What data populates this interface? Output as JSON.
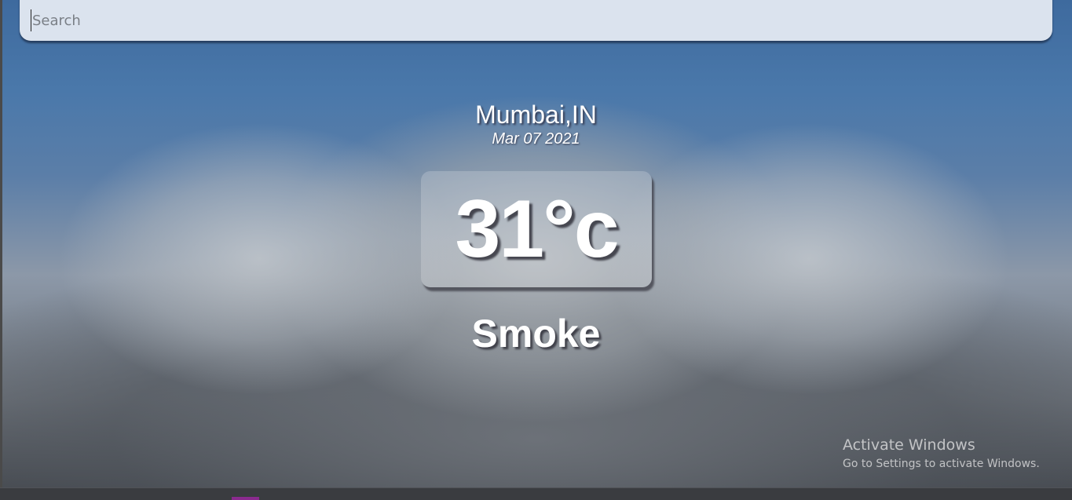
{
  "search": {
    "placeholder": "Search",
    "value": ""
  },
  "weather": {
    "location": "Mumbai,IN",
    "date": "Mar 07 2021",
    "temperature": "31°c",
    "condition": "Smoke"
  },
  "watermark": {
    "title": "Activate Windows",
    "subtitle": "Go to Settings to activate Windows."
  },
  "colors": {
    "search_bg": "#dbe3ee",
    "sky_top": "#3e6a9e",
    "text": "#ffffff",
    "taskbar_accent": "#8a2a8e"
  }
}
